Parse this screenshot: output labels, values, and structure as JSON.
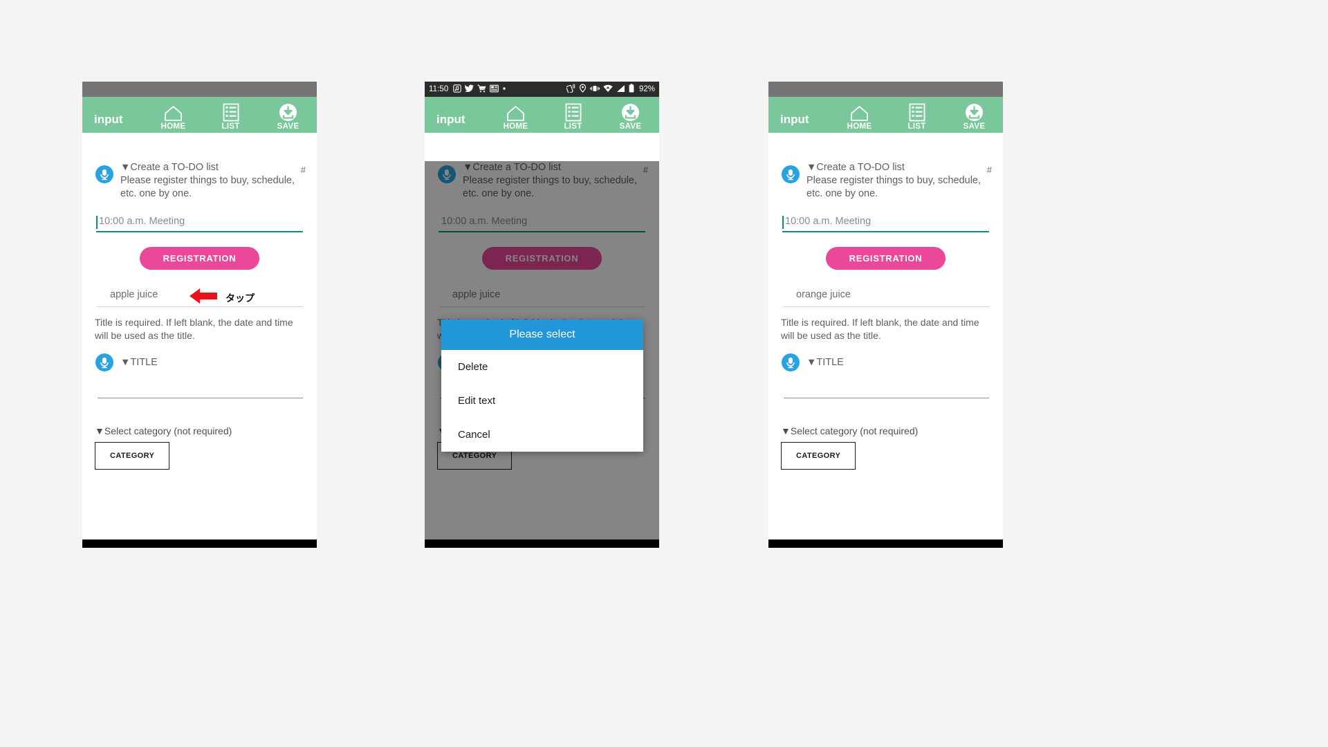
{
  "app": {
    "title": "input",
    "actions": [
      {
        "label": "HOME",
        "icon": "home-icon"
      },
      {
        "label": "LIST",
        "icon": "list-icon"
      },
      {
        "label": "SAVE",
        "icon": "save-download-icon"
      }
    ],
    "accent_green": "#7ac79c",
    "accent_pink": "#ec4899",
    "accent_teal": "#009178",
    "accent_blue": "#29a3e0",
    "dialog_blue": "#2196d8"
  },
  "content": {
    "hash_marker": "#",
    "intro_title": "▼Create a TO-DO list",
    "intro_body": "Please register things to buy, schedule, etc. one by one.",
    "input_value": "10:00 a.m. Meeting",
    "registration_button": "REGISTRATION",
    "hint": "Title is required. If left blank, the date and time will be used as the title.",
    "title_field_label": "▼TITLE",
    "category_label": "▼Select category (not required)",
    "category_button": "CATEGORY"
  },
  "panel1": {
    "list_item": "apple juice",
    "annotation": "タップ",
    "annotation_arrow": "red-left-arrow-icon"
  },
  "panel2": {
    "statusbar": {
      "time": "11:50",
      "battery_percent": "92%",
      "left_icons": [
        "music-note-icon",
        "twitter-bird-icon",
        "shopping-cart-icon",
        "news-icon",
        "dot-icon"
      ],
      "right_icons": [
        "nfc-icon",
        "location-pin-icon",
        "vibrate-icon",
        "wifi-icon",
        "signal-icon",
        "battery-icon"
      ]
    },
    "dialog": {
      "header": "Please select",
      "items": [
        "Delete",
        "Edit text",
        "Cancel"
      ]
    },
    "list_item": "apple juice",
    "navbar": {
      "back": "back-triangle-icon",
      "home": "home-circle-icon",
      "recent": "recent-square-icon"
    }
  },
  "panel3": {
    "list_item": "orange juice"
  }
}
